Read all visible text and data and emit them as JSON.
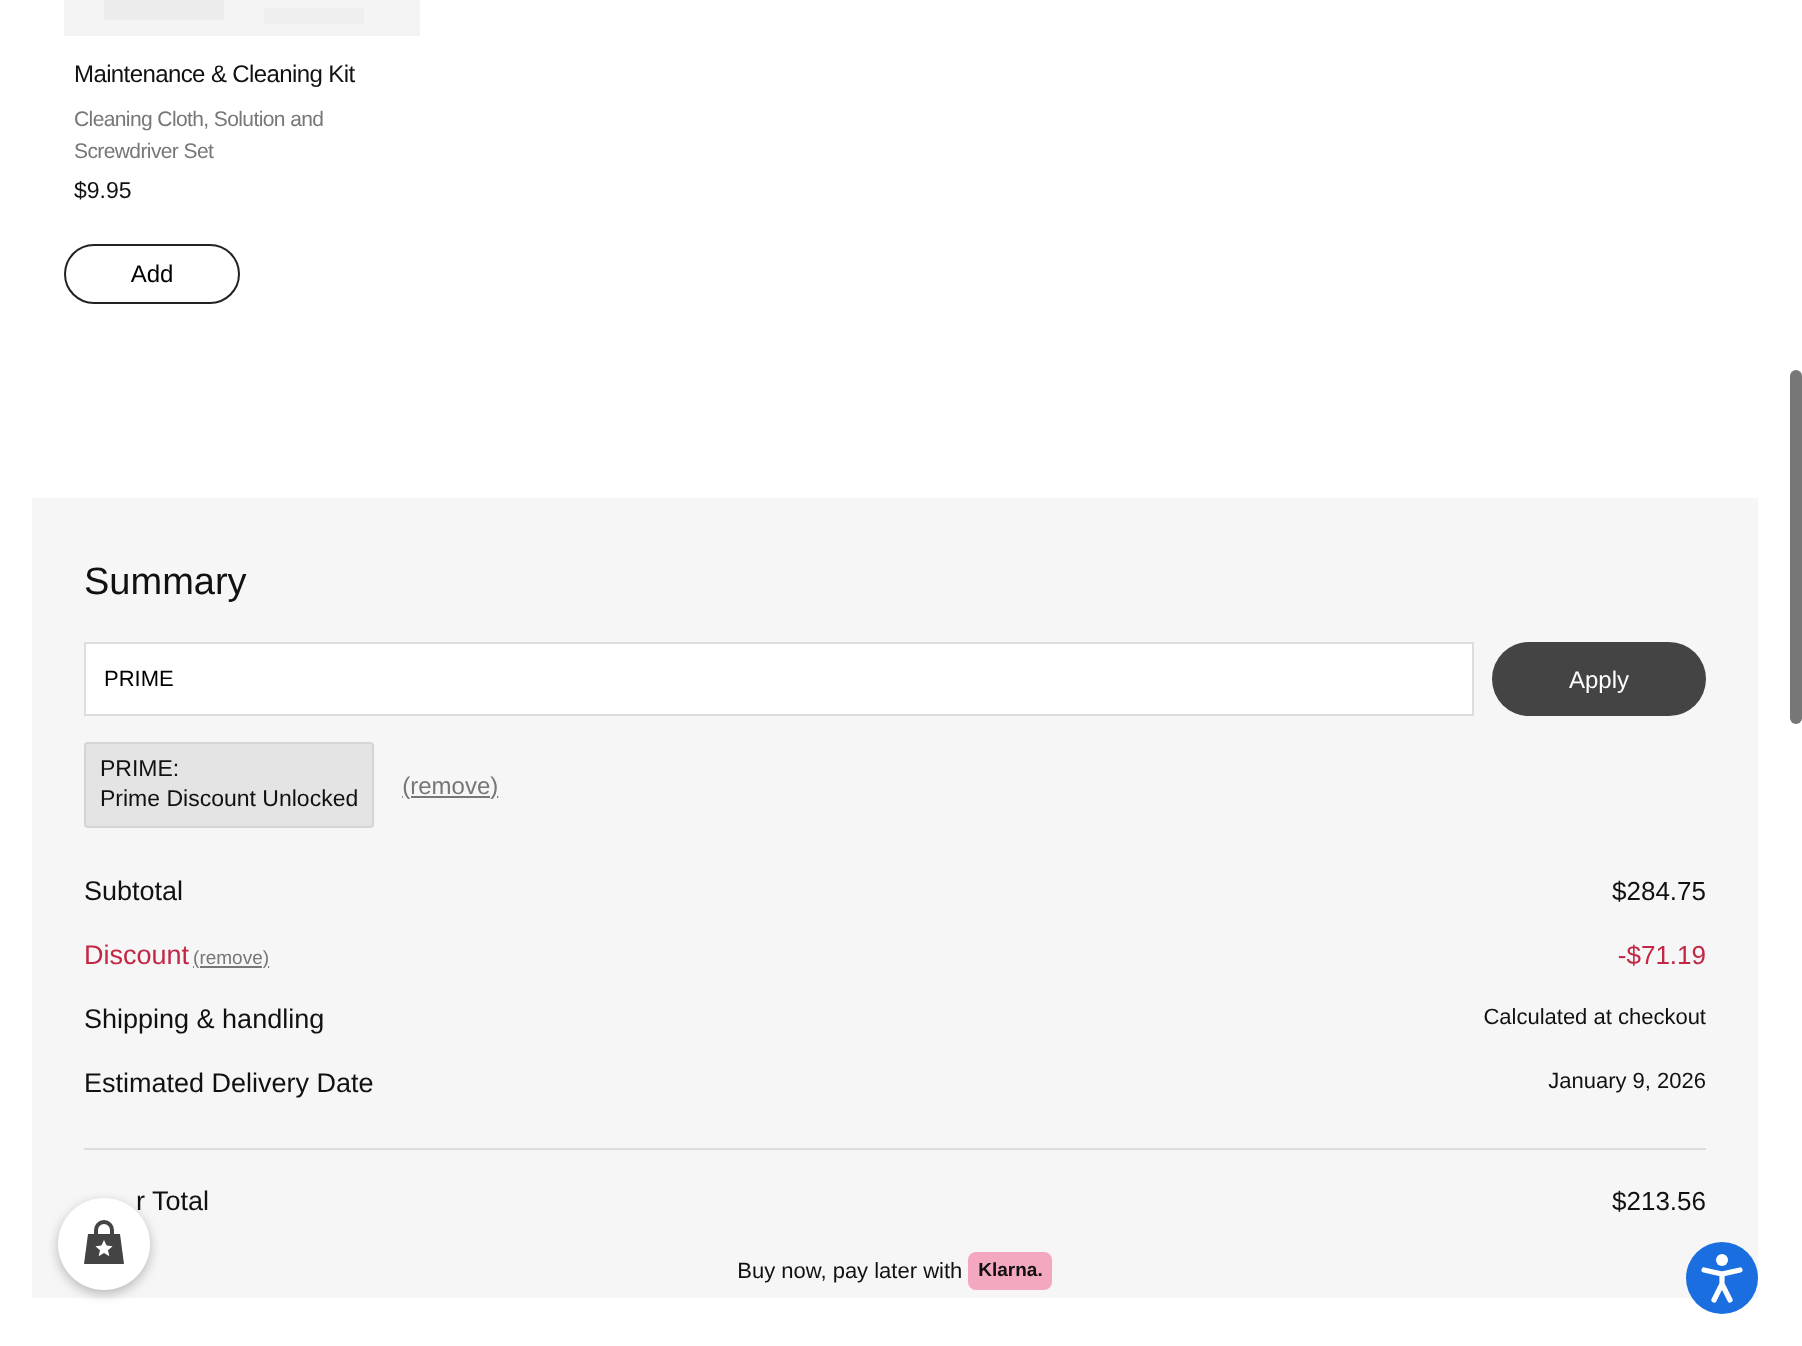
{
  "product": {
    "name": "Maintenance & Cleaning Kit",
    "description": "Cleaning Cloth, Solution and Screwdriver Set",
    "price": "$9.95",
    "button": "Add"
  },
  "summary": {
    "title": "Summary",
    "promo_field": {
      "value": "PRIME"
    },
    "apply_button": "Apply",
    "applied_code": {
      "code": "PRIME:",
      "message": "Prime Discount Unlocked",
      "remove": "(remove)"
    },
    "lines": [
      {
        "kind": "plain",
        "label": "Subtotal",
        "value": "$284.75"
      },
      {
        "kind": "discount",
        "label": "Discount",
        "remove": "(remove)",
        "value": "-$71.19"
      },
      {
        "kind": "note",
        "label": "Shipping & handling",
        "value": "Calculated at checkout"
      },
      {
        "kind": "note",
        "label": "Estimated Delivery Date",
        "value": "January 9, 2026"
      }
    ],
    "total": {
      "label": "r Total",
      "value": "$213.56"
    },
    "pay_later": {
      "text": "Buy now, pay later with",
      "badge": "Klarna."
    }
  }
}
